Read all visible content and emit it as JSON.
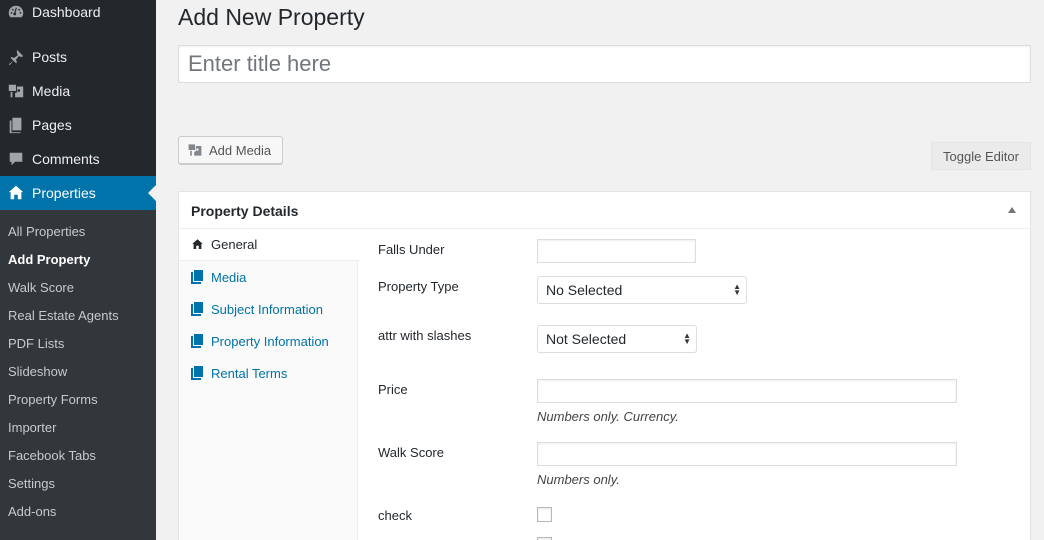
{
  "sidebar": {
    "items": [
      {
        "label": "Dashboard",
        "icon": "dashboard-icon"
      },
      {
        "label": "Posts",
        "icon": "pin-icon"
      },
      {
        "label": "Media",
        "icon": "media-icon"
      },
      {
        "label": "Pages",
        "icon": "pages-icon"
      },
      {
        "label": "Comments",
        "icon": "comment-icon"
      },
      {
        "label": "Properties",
        "icon": "home-icon",
        "active": true
      }
    ],
    "submenu": [
      "All Properties",
      "Add Property",
      "Walk Score",
      "Real Estate Agents",
      "PDF Lists",
      "Slideshow",
      "Property Forms",
      "Importer",
      "Facebook Tabs",
      "Settings",
      "Add-ons"
    ],
    "current_submenu": "Add Property"
  },
  "main": {
    "page_title": "Add New Property",
    "title_placeholder": "Enter title here",
    "add_media_label": "Add Media",
    "toggle_editor_label": "Toggle Editor"
  },
  "metabox": {
    "title": "Property Details",
    "tabs": [
      {
        "label": "General",
        "icon": "home-icon",
        "active": true
      },
      {
        "label": "Media",
        "icon": "book-icon"
      },
      {
        "label": "Subject Information",
        "icon": "book-icon"
      },
      {
        "label": "Property Information",
        "icon": "book-icon"
      },
      {
        "label": "Rental Terms",
        "icon": "book-icon"
      }
    ],
    "fields": {
      "falls_under": {
        "label": "Falls Under",
        "value": ""
      },
      "property_type": {
        "label": "Property Type",
        "value": "No Selected"
      },
      "attr_slashes": {
        "label": "attr with slashes",
        "value": "Not Selected"
      },
      "price": {
        "label": "Price",
        "value": "",
        "description": "Numbers only. Currency."
      },
      "walk_score": {
        "label": "Walk Score",
        "value": "",
        "description": "Numbers only."
      },
      "check": {
        "label": "check",
        "checked": false
      }
    }
  },
  "colors": {
    "sidebar_bg": "#23282d",
    "submenu_bg": "#32373c",
    "accent": "#0073aa",
    "page_bg": "#f1f1f1"
  }
}
